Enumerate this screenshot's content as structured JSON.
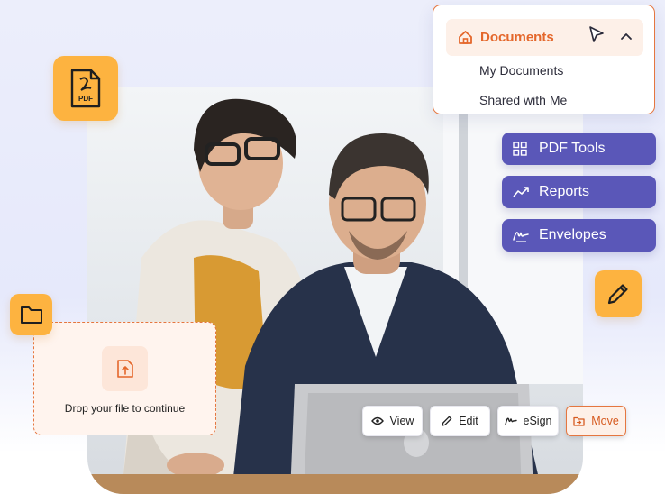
{
  "documents_menu": {
    "title": "Documents",
    "items": [
      "My Documents",
      "Shared with Me"
    ]
  },
  "nav": {
    "items": [
      {
        "label": "PDF Tools",
        "icon": "grid-icon"
      },
      {
        "label": "Reports",
        "icon": "trend-up-icon"
      },
      {
        "label": "Envelopes",
        "icon": "signature-icon"
      }
    ]
  },
  "tiles": {
    "pdf_badge": "PDF"
  },
  "drop_zone": {
    "text": "Drop your file to continue"
  },
  "actions": {
    "view": "View",
    "edit": "Edit",
    "esign": "eSign",
    "move": "Move"
  },
  "colors": {
    "accent_orange": "#e5763f",
    "tile_yellow": "#fdb340",
    "nav_purple": "#5a57b8"
  }
}
